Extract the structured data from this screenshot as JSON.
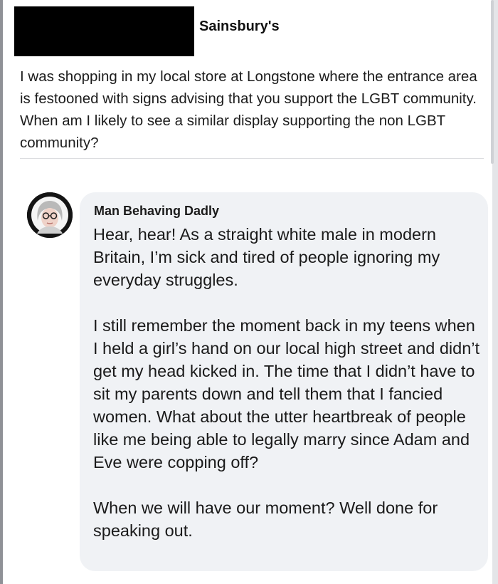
{
  "post": {
    "page_name": "Sainsbury's",
    "text": "I was shopping in my local store at Longstone where the entrance area is festooned with signs advising that you support the LGBT community. When am I likely to see a similar display supporting the  non LGBT community?"
  },
  "comment": {
    "author": "Man Behaving Dadly",
    "paragraphs": [
      "Hear, hear! As a straight white male in modern Britain, I’m sick and tired of people ignoring my everyday struggles.",
      "I still remember the moment back in my teens when I held a girl’s hand on our local high street and didn’t get my head kicked in. The time that I didn’t have to sit my parents down and tell them that I fancied women. What about the utter heartbreak of people like me being able to legally marry since Adam and Eve were copping off?",
      "When we will have our moment? Well done for speaking out."
    ]
  }
}
